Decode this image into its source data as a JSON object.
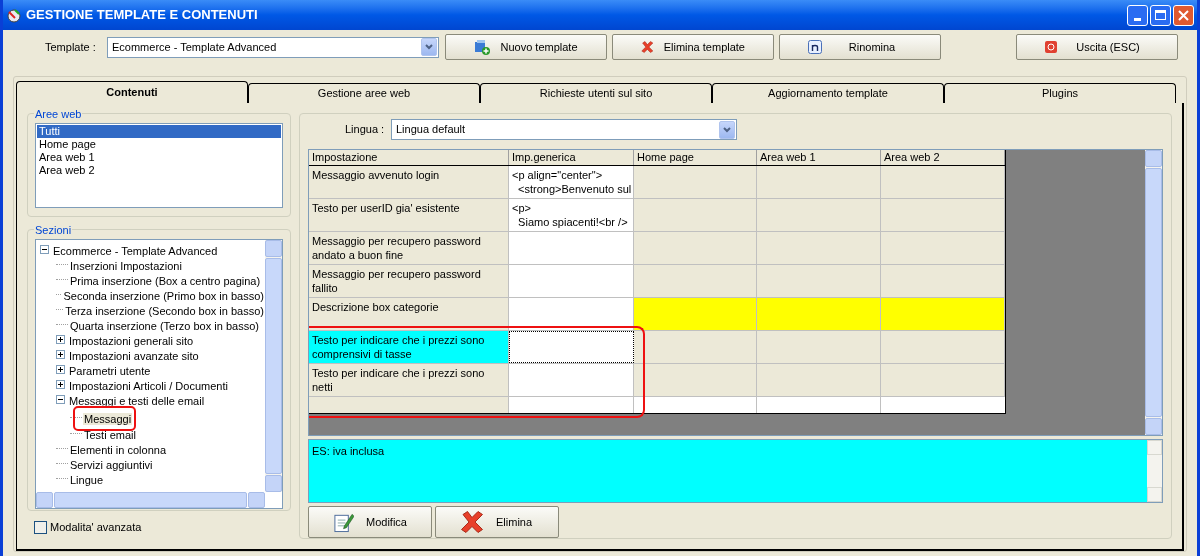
{
  "window": {
    "title": "GESTIONE TEMPLATE E CONTENUTI"
  },
  "toolbar": {
    "template_label": "Template :",
    "template_value": "Ecommerce - Template Advanced",
    "buttons": [
      {
        "kind": "new",
        "label": "Nuovo template"
      },
      {
        "kind": "delete",
        "label": "Elimina template"
      },
      {
        "kind": "rename",
        "label": "Rinomina"
      },
      {
        "kind": "exit",
        "label": "Uscita (ESC)"
      }
    ]
  },
  "tabs": [
    {
      "label": "Contenuti",
      "selected": true
    },
    {
      "label": "Gestione aree web",
      "selected": false
    },
    {
      "label": "Richieste utenti sul sito",
      "selected": false
    },
    {
      "label": "Aggiornamento template",
      "selected": false
    },
    {
      "label": "Plugins",
      "selected": false
    }
  ],
  "aree_web": {
    "title": "Aree web",
    "items": [
      {
        "label": "Tutti",
        "selected": true
      },
      {
        "label": "Home page",
        "selected": false
      },
      {
        "label": "Area web 1",
        "selected": false
      },
      {
        "label": "Area web 2",
        "selected": false
      }
    ]
  },
  "sezioni": {
    "title": "Sezioni",
    "tree": [
      {
        "label": "Ecommerce - Template Advanced",
        "expanded": true,
        "selected": false,
        "annotated": false,
        "children": [
          {
            "label": "Inserzioni Impostazioni",
            "selected": false,
            "annotated": false
          },
          {
            "label": "Prima inserzione (Box a centro pagina)",
            "selected": false,
            "annotated": false
          },
          {
            "label": "Seconda inserzione (Primo box in basso)",
            "selected": false,
            "annotated": false
          },
          {
            "label": "Terza inserzione (Secondo box in basso)",
            "selected": false,
            "annotated": false
          },
          {
            "label": "Quarta inserzione (Terzo box in basso)",
            "selected": false,
            "annotated": false
          },
          {
            "label": "Impostazioni generali sito",
            "expanded": false,
            "selected": false,
            "annotated": false
          },
          {
            "label": "Impostazioni avanzate sito",
            "expanded": false,
            "selected": false,
            "annotated": false
          },
          {
            "label": "Parametri utente",
            "expanded": false,
            "selected": false,
            "annotated": false
          },
          {
            "label": "Impostazioni Articoli / Documenti",
            "expanded": false,
            "selected": false,
            "annotated": false
          },
          {
            "label": "Messaggi e testi delle email",
            "expanded": true,
            "selected": false,
            "annotated": false,
            "children": [
              {
                "label": "Messaggi",
                "selected": true,
                "annotated": true
              },
              {
                "label": "Testi email",
                "selected": false,
                "annotated": false
              }
            ]
          },
          {
            "label": "Elementi in colonna",
            "selected": false,
            "annotated": false
          },
          {
            "label": "Servizi aggiuntivi",
            "selected": false,
            "annotated": false
          },
          {
            "label": "Lingue",
            "selected": false,
            "annotated": false
          }
        ]
      }
    ],
    "advanced_mode": {
      "label": "Modalita' avanzata",
      "checked": false
    }
  },
  "lingua": {
    "label": "Lingua :",
    "value": "Lingua default"
  },
  "table": {
    "columns": [
      "Impostazione",
      "Imp.generica",
      "Home page",
      "Area web 1",
      "Area web 2"
    ],
    "rows": [
      {
        "setting": "Messaggio avvenuto login",
        "generic": [
          "<p align=\"center\">",
          "  <strong>Benvenuto sul"
        ],
        "selected": false,
        "flagged": false,
        "annotated": false
      },
      {
        "setting": "Testo per userID gia' esistente",
        "generic": [
          "<p>",
          "  Siamo spiacenti!<br />"
        ],
        "selected": false,
        "flagged": false,
        "annotated": false
      },
      {
        "setting": "Messaggio per recupero password andato a buon fine",
        "generic": [],
        "selected": false,
        "flagged": false,
        "annotated": false
      },
      {
        "setting": "Messaggio per recupero password fallito",
        "generic": [],
        "selected": false,
        "flagged": false,
        "annotated": false
      },
      {
        "setting": "Descrizione box categorie",
        "generic": [],
        "selected": false,
        "flagged": true,
        "annotated": false
      },
      {
        "setting": "Testo per indicare che i prezzi sono comprensivi di tasse",
        "generic": [],
        "selected": true,
        "flagged": false,
        "annotated": true
      },
      {
        "setting": "Testo per indicare che i prezzi sono netti",
        "generic": [],
        "selected": false,
        "flagged": false,
        "annotated": true
      }
    ]
  },
  "memo": {
    "value": "ES: iva inclusa"
  },
  "actions": [
    {
      "kind": "edit",
      "label": "Modifica"
    },
    {
      "kind": "delete",
      "label": "Elimina"
    }
  ]
}
